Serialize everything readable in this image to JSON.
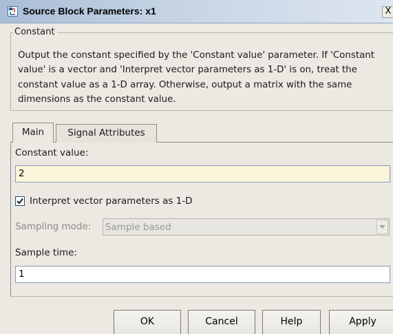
{
  "window": {
    "title": "Source Block Parameters: x1",
    "close_label": "X"
  },
  "block": {
    "group_label": "Constant",
    "description": "Output the constant specified by the 'Constant value' parameter. If 'Constant value' is a vector and 'Interpret vector parameters as 1-D' is on, treat the constant value as a 1-D array. Otherwise, output a matrix with the same dimensions as the constant value."
  },
  "tabs": [
    {
      "label": "Main",
      "selected": true
    },
    {
      "label": "Signal Attributes",
      "selected": false
    }
  ],
  "main": {
    "constant_value_label": "Constant value:",
    "constant_value": "2",
    "interpret_checkbox_label": "Interpret vector parameters as 1-D",
    "interpret_checked": true,
    "sampling_mode_label": "Sampling mode:",
    "sampling_mode_value": "Sample based",
    "sampling_mode_enabled": false,
    "sample_time_label": "Sample time:",
    "sample_time": "1"
  },
  "buttons": {
    "ok": "OK",
    "cancel": "Cancel",
    "help": "Help",
    "apply": "Apply"
  },
  "icons": {
    "window_icon": "simulink-block-icon",
    "checkbox": "checkmark-icon",
    "dropdown": "chevron-down-icon"
  }
}
